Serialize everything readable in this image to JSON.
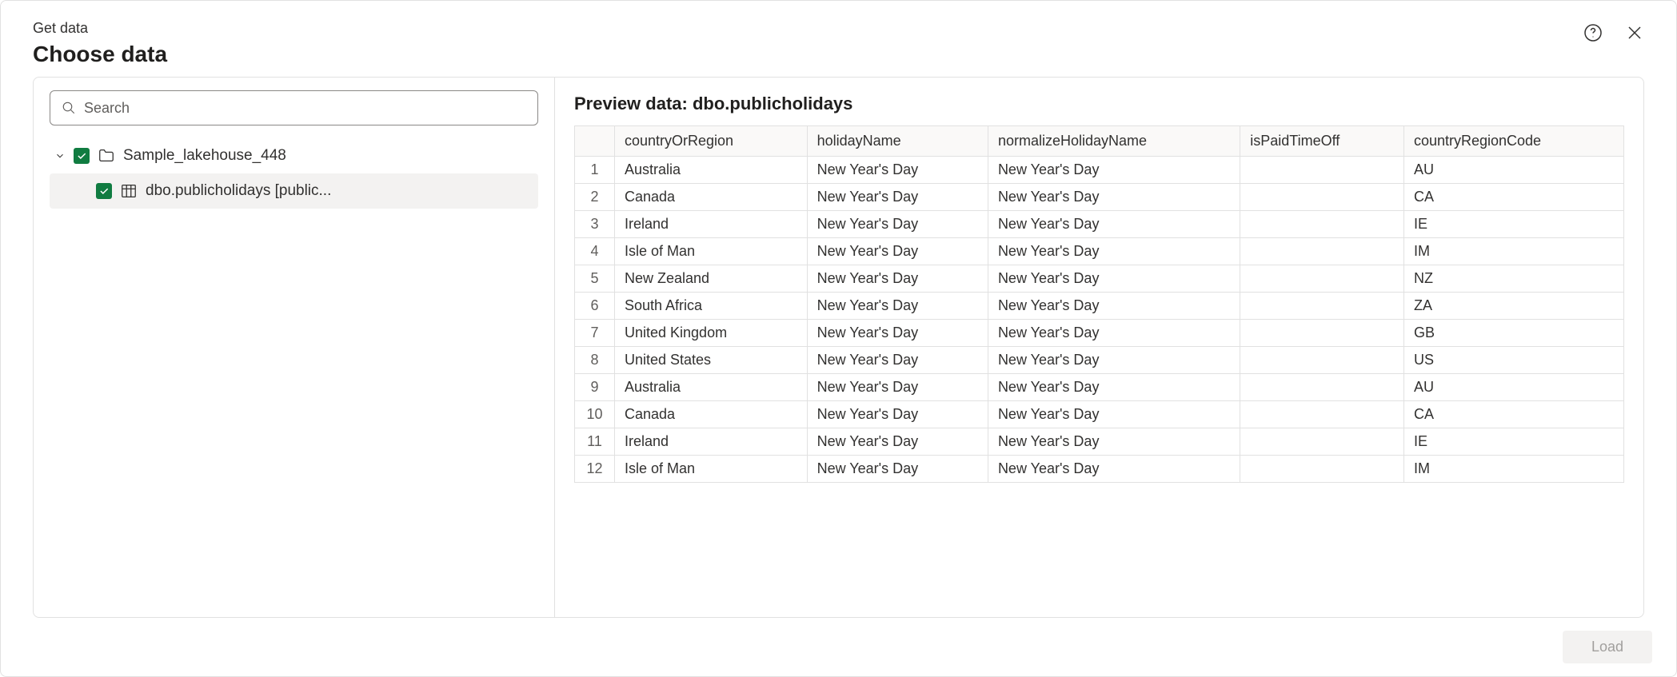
{
  "header": {
    "breadcrumb": "Get data",
    "title": "Choose data"
  },
  "search": {
    "placeholder": "Search",
    "value": ""
  },
  "tree": {
    "root_label": "Sample_lakehouse_448",
    "child_label": "dbo.publicholidays [public..."
  },
  "preview": {
    "title": "Preview data: dbo.publicholidays",
    "columns": [
      "countryOrRegion",
      "holidayName",
      "normalizeHolidayName",
      "isPaidTimeOff",
      "countryRegionCode"
    ],
    "rows": [
      {
        "n": "1",
        "countryOrRegion": "Australia",
        "holidayName": "New Year's Day",
        "normalizeHolidayName": "New Year's Day",
        "isPaidTimeOff": "",
        "countryRegionCode": "AU"
      },
      {
        "n": "2",
        "countryOrRegion": "Canada",
        "holidayName": "New Year's Day",
        "normalizeHolidayName": "New Year's Day",
        "isPaidTimeOff": "",
        "countryRegionCode": "CA"
      },
      {
        "n": "3",
        "countryOrRegion": "Ireland",
        "holidayName": "New Year's Day",
        "normalizeHolidayName": "New Year's Day",
        "isPaidTimeOff": "",
        "countryRegionCode": "IE"
      },
      {
        "n": "4",
        "countryOrRegion": "Isle of Man",
        "holidayName": "New Year's Day",
        "normalizeHolidayName": "New Year's Day",
        "isPaidTimeOff": "",
        "countryRegionCode": "IM"
      },
      {
        "n": "5",
        "countryOrRegion": "New Zealand",
        "holidayName": "New Year's Day",
        "normalizeHolidayName": "New Year's Day",
        "isPaidTimeOff": "",
        "countryRegionCode": "NZ"
      },
      {
        "n": "6",
        "countryOrRegion": "South Africa",
        "holidayName": "New Year's Day",
        "normalizeHolidayName": "New Year's Day",
        "isPaidTimeOff": "",
        "countryRegionCode": "ZA"
      },
      {
        "n": "7",
        "countryOrRegion": "United Kingdom",
        "holidayName": "New Year's Day",
        "normalizeHolidayName": "New Year's Day",
        "isPaidTimeOff": "",
        "countryRegionCode": "GB"
      },
      {
        "n": "8",
        "countryOrRegion": "United States",
        "holidayName": "New Year's Day",
        "normalizeHolidayName": "New Year's Day",
        "isPaidTimeOff": "",
        "countryRegionCode": "US"
      },
      {
        "n": "9",
        "countryOrRegion": "Australia",
        "holidayName": "New Year's Day",
        "normalizeHolidayName": "New Year's Day",
        "isPaidTimeOff": "",
        "countryRegionCode": "AU"
      },
      {
        "n": "10",
        "countryOrRegion": "Canada",
        "holidayName": "New Year's Day",
        "normalizeHolidayName": "New Year's Day",
        "isPaidTimeOff": "",
        "countryRegionCode": "CA"
      },
      {
        "n": "11",
        "countryOrRegion": "Ireland",
        "holidayName": "New Year's Day",
        "normalizeHolidayName": "New Year's Day",
        "isPaidTimeOff": "",
        "countryRegionCode": "IE"
      },
      {
        "n": "12",
        "countryOrRegion": "Isle of Man",
        "holidayName": "New Year's Day",
        "normalizeHolidayName": "New Year's Day",
        "isPaidTimeOff": "",
        "countryRegionCode": "IM"
      }
    ]
  },
  "footer": {
    "load_label": "Load"
  }
}
